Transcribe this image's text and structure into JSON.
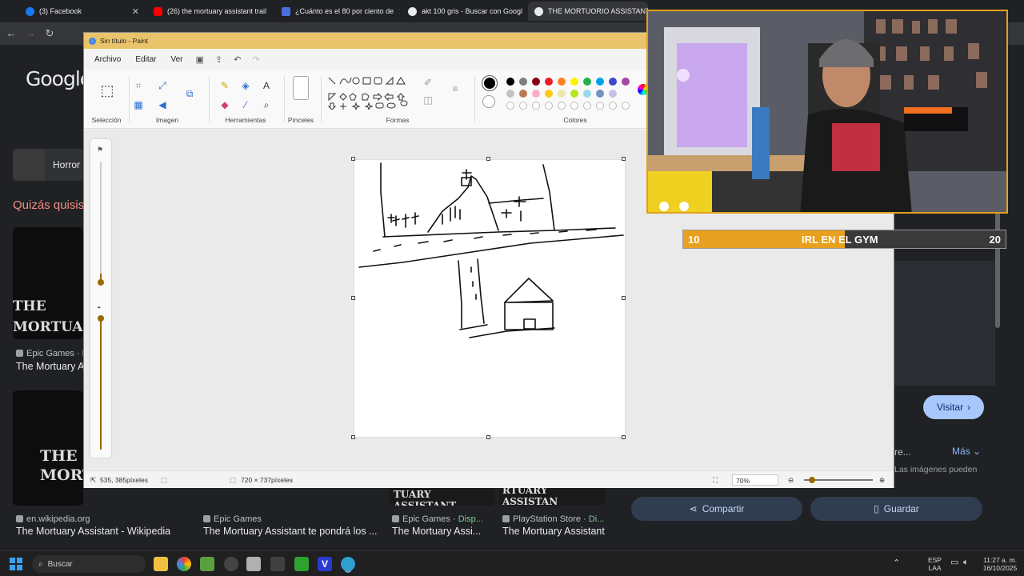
{
  "browser": {
    "tabs": [
      {
        "label": "(3) Facebook",
        "color": "#1877f2"
      },
      {
        "label": "(26) the mortuary assistant trail",
        "color": "#ff0000"
      },
      {
        "label": "¿Cuánto es el 80 por ciento de",
        "color": "#4a6ee0"
      },
      {
        "label": "akt 100 gris - Buscar con Googl",
        "color": "#e8eaed"
      },
      {
        "label": "THE MORTUORIO ASSISTANT",
        "color": "#e8eaed"
      }
    ]
  },
  "google": {
    "logo": "Google",
    "chip_label": "Horror",
    "quizas": "Quizás quisis",
    "results": [
      {
        "source": "Epic Games · D",
        "title": "The Mortuary As"
      },
      {
        "source": "en.wikipedia.org",
        "title": "The Mortuary Assistant - Wikipedia"
      },
      {
        "source": "Epic Games",
        "title": "The Mortuary Assistant te pondrá los ..."
      },
      {
        "source": "Epic Games",
        "source_extra": "Disp...",
        "title": "The Mortuary Assi..."
      },
      {
        "source": "PlayStation Store",
        "source_extra": "Di...",
        "title": "The Mortuary Assistant"
      }
    ],
    "card_texts": {
      "the_mortuary": "THE MORTUARY",
      "the_mort": "THE MORT",
      "tuary_assistant_1": "TUARY ASSISTANT",
      "tuary_assistant_2": "RTUARY ASSISTAN"
    },
    "visitar": "Visitar",
    "mas": "Más",
    "re": "re...",
    "imgs_note": "Las imágenes pueden",
    "compartir": "Compartir",
    "guardar": "Guardar"
  },
  "paint": {
    "title": "Sin título - Paint",
    "menu": [
      "Archivo",
      "Editar",
      "Ver"
    ],
    "groups": {
      "seleccion": "Selección",
      "imagen": "Imagen",
      "herramientas": "Herramientas",
      "pinceles": "Pinceles",
      "formas": "Formas",
      "colores": "Colores"
    },
    "palette": [
      "#000000",
      "#7f7f7f",
      "#880015",
      "#ed1c24",
      "#ff7f27",
      "#fff200",
      "#22b14c",
      "#00a2e8",
      "#3f48cc",
      "#a349a4"
    ],
    "palette2": [
      "#c3c3c3",
      "#b97a57",
      "#ffaec9",
      "#ffc90e",
      "#efe4b0",
      "#b5e61d",
      "#99d9ea",
      "#7092be",
      "#c8bfe7"
    ],
    "status": {
      "cursor": "535, 385píxeles",
      "size": "720 × 737píxeles",
      "zoom": "70%"
    }
  },
  "stream": {
    "bar_left": "10",
    "bar_center": "IRL EN EL GYM",
    "bar_right": "20",
    "progress": 0.5
  },
  "taskbar": {
    "search": "Buscar",
    "lang1": "ESP",
    "lang2": "LAA",
    "time": "11:27 a. m.",
    "date": "16/10/2025"
  }
}
